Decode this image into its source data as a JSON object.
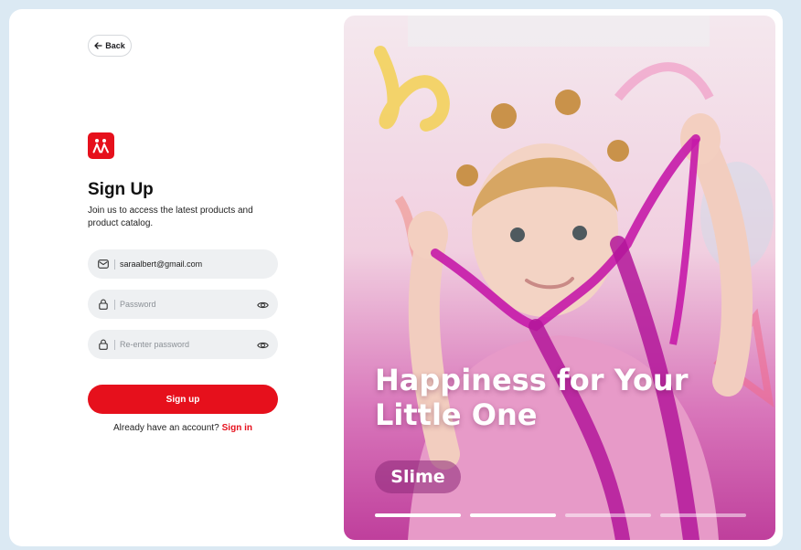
{
  "back": {
    "label": "Back",
    "icon": "arrow-left-icon"
  },
  "brand": {
    "logo_icon": "people-logo-icon",
    "color": "#e6101c"
  },
  "form": {
    "title": "Sign Up",
    "subtitle": "Join us to access the latest products and product catalog.",
    "email": {
      "value": "saraalbert@gmail.com",
      "icon": "mail-icon"
    },
    "password": {
      "placeholder": "Password",
      "icon": "lock-icon",
      "toggle_icon": "eye-icon"
    },
    "confirm": {
      "placeholder": "Re-enter password",
      "icon": "lock-icon",
      "toggle_icon": "eye-icon"
    },
    "submit_label": "Sign up",
    "signin_prompt": "Already have an account?",
    "signin_link": "Sign in"
  },
  "hero": {
    "headline": "Happiness for Your Little One",
    "tag": "Slime",
    "slides_total": 4,
    "active_slides": 2
  },
  "colors": {
    "accent": "#e6101c",
    "background": "#dbe9f3",
    "field": "#eef0f2"
  }
}
